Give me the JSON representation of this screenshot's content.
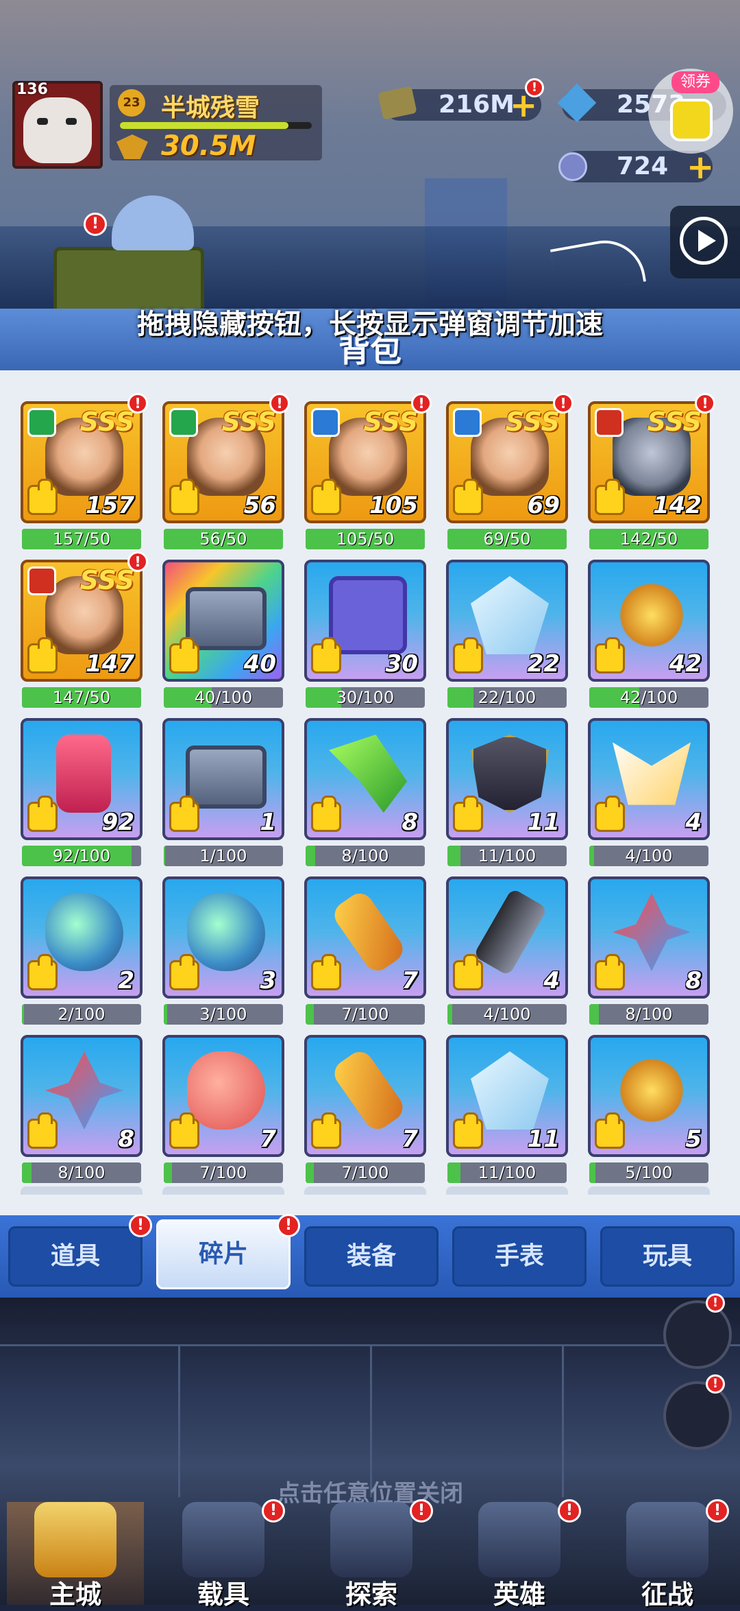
{
  "player": {
    "level": "136",
    "vip_level": "23",
    "name": "半城残雪",
    "power": "30.5M",
    "exp_progress": 0.88
  },
  "resources": {
    "cash": "216M",
    "gems": "2573",
    "coins": "724"
  },
  "coupon_label": "领券",
  "hint": "拖拽隐藏按钮，长按显示弹窗调节加速",
  "panel_title": "背包",
  "items": [
    {
      "tier": "SSS",
      "emblem": "g",
      "art": "face",
      "count": "157",
      "progress": "157/50",
      "fill": 1.0,
      "alert": true,
      "gold": true
    },
    {
      "tier": "SSS",
      "emblem": "g",
      "art": "face",
      "count": "56",
      "progress": "56/50",
      "fill": 1.0,
      "alert": true,
      "gold": true
    },
    {
      "tier": "SSS",
      "emblem": "b",
      "art": "face",
      "count": "105",
      "progress": "105/50",
      "fill": 1.0,
      "alert": true,
      "gold": true
    },
    {
      "tier": "SSS",
      "emblem": "b",
      "art": "face",
      "count": "69",
      "progress": "69/50",
      "fill": 1.0,
      "alert": true,
      "gold": true
    },
    {
      "tier": "SSS",
      "emblem": "r",
      "art": "robot",
      "count": "142",
      "progress": "142/50",
      "fill": 1.0,
      "alert": true,
      "gold": true
    },
    {
      "tier": "SSS",
      "emblem": "r",
      "art": "face",
      "count": "147",
      "progress": "147/50",
      "fill": 1.0,
      "alert": true,
      "gold": true
    },
    {
      "art": "box",
      "count": "40",
      "progress": "40/100",
      "fill": 0.4,
      "rainbow": true
    },
    {
      "art": "puzzle",
      "count": "30",
      "progress": "30/100",
      "fill": 0.3
    },
    {
      "art": "crystal",
      "count": "22",
      "progress": "22/100",
      "fill": 0.22
    },
    {
      "art": "ring",
      "count": "42",
      "progress": "42/100",
      "fill": 0.42
    },
    {
      "art": "pod",
      "count": "92",
      "progress": "92/100",
      "fill": 0.92
    },
    {
      "art": "box",
      "count": "1",
      "progress": "1/100",
      "fill": 0.01
    },
    {
      "art": "blade",
      "count": "8",
      "progress": "8/100",
      "fill": 0.08
    },
    {
      "art": "shield",
      "count": "11",
      "progress": "11/100",
      "fill": 0.11
    },
    {
      "art": "wingx",
      "count": "4",
      "progress": "4/100",
      "fill": 0.04
    },
    {
      "art": "blob",
      "count": "2",
      "progress": "2/100",
      "fill": 0.02
    },
    {
      "art": "blob",
      "count": "3",
      "progress": "3/100",
      "fill": 0.03
    },
    {
      "art": "tool",
      "count": "7",
      "progress": "7/100",
      "fill": 0.07
    },
    {
      "art": "pipe",
      "count": "4",
      "progress": "4/100",
      "fill": 0.04
    },
    {
      "art": "shard",
      "count": "8",
      "progress": "8/100",
      "fill": 0.08
    },
    {
      "art": "shard",
      "count": "8",
      "progress": "8/100",
      "fill": 0.08
    },
    {
      "art": "fish",
      "count": "7",
      "progress": "7/100",
      "fill": 0.07
    },
    {
      "art": "tool",
      "count": "7",
      "progress": "7/100",
      "fill": 0.07
    },
    {
      "art": "crystal",
      "count": "11",
      "progress": "11/100",
      "fill": 0.11
    },
    {
      "art": "ring",
      "count": "5",
      "progress": "5/100",
      "fill": 0.05
    }
  ],
  "tabs": [
    {
      "label": "道具",
      "alert": true
    },
    {
      "label": "碎片",
      "alert": true,
      "active": true
    },
    {
      "label": "装备"
    },
    {
      "label": "手表"
    },
    {
      "label": "玩具"
    }
  ],
  "close_hint": "点击任意位置关闭",
  "nav": [
    "主城",
    "载具",
    "探索",
    "英雄",
    "征战"
  ],
  "colors": {
    "accent": "#3a73d6",
    "progress_fill": "#4cc24a",
    "alert": "#e32222",
    "gold": "#ffe14a"
  }
}
